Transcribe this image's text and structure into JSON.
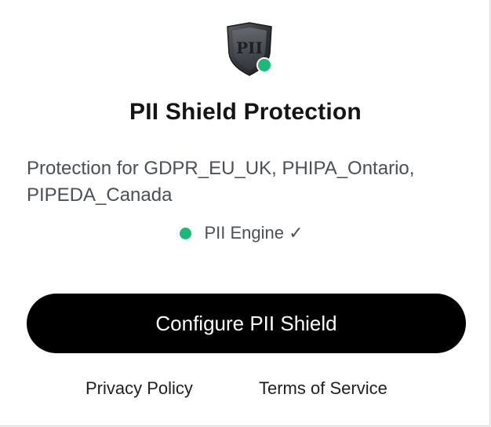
{
  "logo": {
    "icon": "shield-icon",
    "text": "PII",
    "status_color": "#1db97b"
  },
  "title": "PII Shield Protection",
  "description": "Protection for GDPR_EU_UK, PHIPA_Ontario, PIPEDA_Canada",
  "engine_status": {
    "label": "PII Engine ✓",
    "status_color": "#1db97b"
  },
  "configure_button": {
    "label": "Configure PII Shield"
  },
  "footer": {
    "privacy_label": "Privacy Policy",
    "terms_label": "Terms of Service"
  }
}
